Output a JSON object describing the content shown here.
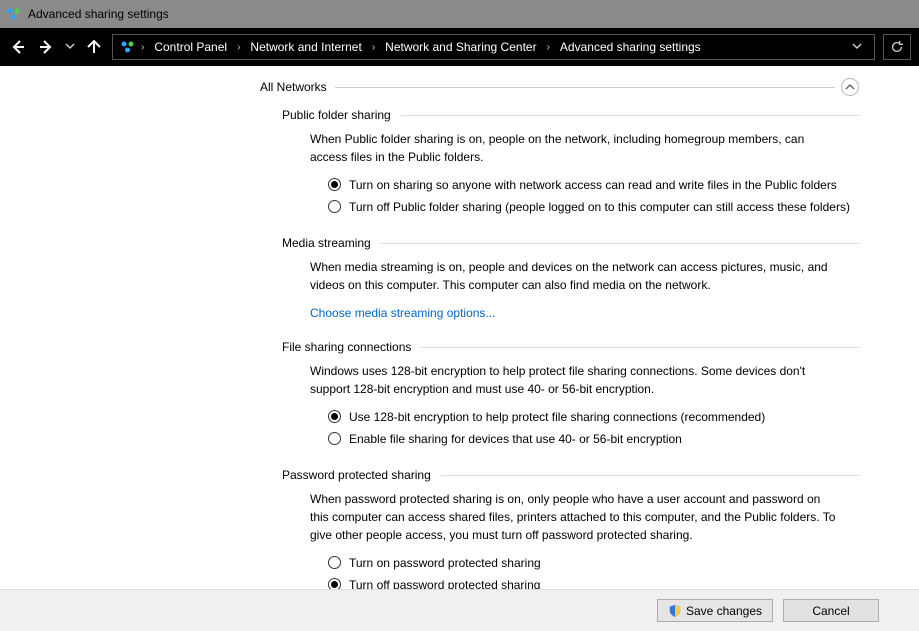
{
  "window": {
    "title": "Advanced sharing settings"
  },
  "breadcrumb": {
    "items": [
      "Control Panel",
      "Network and Internet",
      "Network and Sharing Center",
      "Advanced sharing settings"
    ]
  },
  "group": {
    "title": "All Networks"
  },
  "sections": {
    "publicFolder": {
      "title": "Public folder sharing",
      "desc": "When Public folder sharing is on, people on the network, including homegroup members, can access files in the Public folders.",
      "opt1": "Turn on sharing so anyone with network access can read and write files in the Public folders",
      "opt2": "Turn off Public folder sharing (people logged on to this computer can still access these folders)"
    },
    "media": {
      "title": "Media streaming",
      "desc": "When media streaming is on, people and devices on the network can access pictures, music, and videos on this computer. This computer can also find media on the network.",
      "link": "Choose media streaming options..."
    },
    "fileConn": {
      "title": "File sharing connections",
      "desc": "Windows uses 128-bit encryption to help protect file sharing connections. Some devices don't support 128-bit encryption and must use 40- or 56-bit encryption.",
      "opt1": "Use 128-bit encryption to help protect file sharing connections (recommended)",
      "opt2": "Enable file sharing for devices that use 40- or 56-bit encryption"
    },
    "password": {
      "title": "Password protected sharing",
      "desc": "When password protected sharing is on, only people who have a user account and password on this computer can access shared files, printers attached to this computer, and the Public folders. To give other people access, you must turn off password protected sharing.",
      "opt1": "Turn on password protected sharing",
      "opt2": "Turn off password protected sharing"
    }
  },
  "footer": {
    "save": "Save changes",
    "cancel": "Cancel"
  }
}
